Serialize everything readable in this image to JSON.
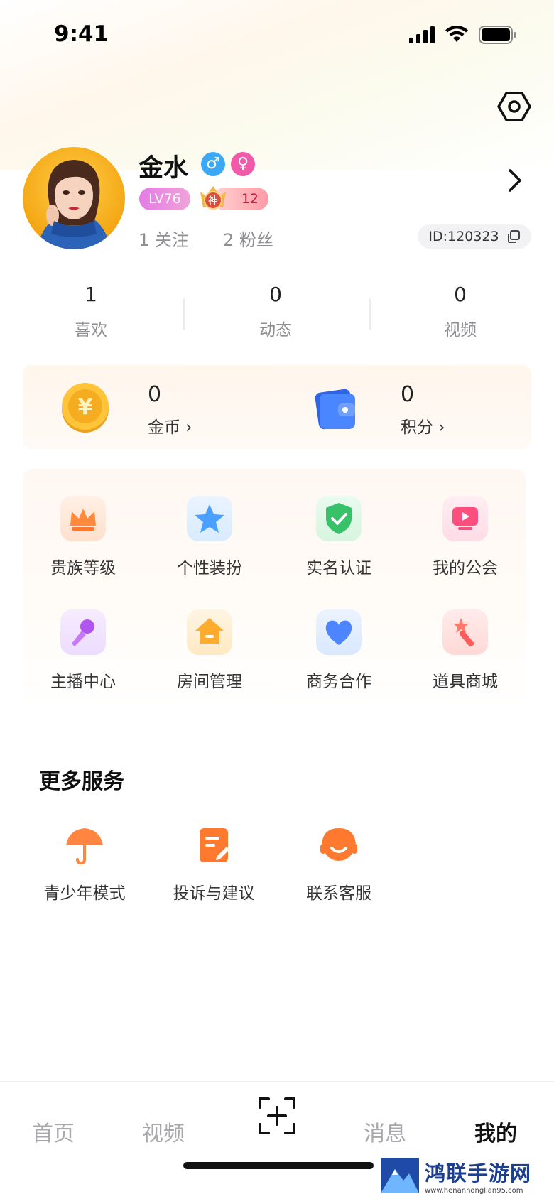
{
  "status_bar": {
    "time": "9:41"
  },
  "profile": {
    "name": "金水",
    "level": "LV76",
    "noble_rank": "12",
    "noble_char": "神",
    "following": "1 关注",
    "fans": "2 粉丝",
    "id": "ID:120323"
  },
  "stats": [
    {
      "value": "1",
      "label": "喜欢"
    },
    {
      "value": "0",
      "label": "动态"
    },
    {
      "value": "0",
      "label": "视频"
    }
  ],
  "wallet": {
    "coins": {
      "value": "0",
      "label": "金币 ›"
    },
    "points": {
      "value": "0",
      "label": "积分 ›"
    }
  },
  "features": [
    {
      "label": "贵族等级",
      "icon": "crown-icon"
    },
    {
      "label": "个性装扮",
      "icon": "star-icon"
    },
    {
      "label": "实名认证",
      "icon": "shield-check-icon"
    },
    {
      "label": "我的公会",
      "icon": "guild-tv-icon"
    },
    {
      "label": "主播中心",
      "icon": "microphone-icon"
    },
    {
      "label": "房间管理",
      "icon": "house-icon"
    },
    {
      "label": "商务合作",
      "icon": "heart-handshake-icon"
    },
    {
      "label": "道具商城",
      "icon": "magic-wand-icon"
    }
  ],
  "more_services": {
    "title": "更多服务",
    "items": [
      {
        "label": "青少年模式",
        "icon": "umbrella-icon"
      },
      {
        "label": "投诉与建议",
        "icon": "edit-note-icon"
      },
      {
        "label": "联系客服",
        "icon": "headset-icon"
      }
    ]
  },
  "tabs": [
    {
      "label": "首页",
      "active": false
    },
    {
      "label": "视频",
      "active": false
    },
    {
      "label": "消息",
      "active": false
    },
    {
      "label": "我的",
      "active": true
    }
  ],
  "watermark": {
    "title": "鸿联手游网",
    "url": "www.henanhonglian95.com"
  },
  "colors": {
    "accent": "#ff7a2f",
    "male": "#3aa8f4",
    "female": "#f05aa9",
    "level_badge": "#e47be6"
  }
}
